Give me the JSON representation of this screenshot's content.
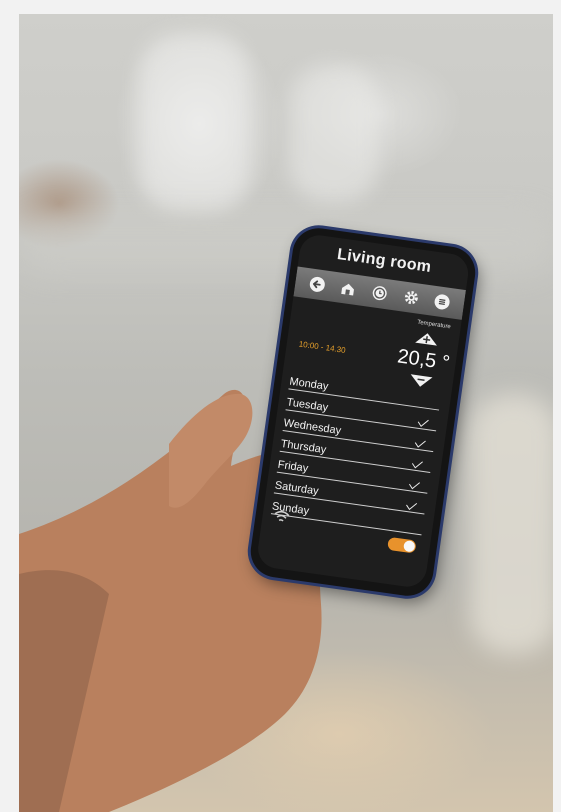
{
  "app": {
    "title": "Living room"
  },
  "toolbar": {
    "icons": [
      "back-arrow-icon",
      "home-icon",
      "clock-icon",
      "gear-icon",
      "menu-icon"
    ]
  },
  "thermostat": {
    "temperature_label": "Temperature",
    "time_range": "10:00 - 14.30",
    "temperature_value": "20,5 °"
  },
  "schedule": {
    "days": [
      {
        "label": "Monday",
        "checked": false
      },
      {
        "label": "Tuesday",
        "checked": true
      },
      {
        "label": "Wednesday",
        "checked": true
      },
      {
        "label": "Thursday",
        "checked": true
      },
      {
        "label": "Friday",
        "checked": true
      },
      {
        "label": "Saturday",
        "checked": true
      },
      {
        "label": "Sunday",
        "checked": false
      }
    ]
  },
  "status": {
    "wifi": "wifi-icon",
    "toggle_on": true
  },
  "colors": {
    "accent": "#e8922c",
    "screen_bg": "#1e1e1e",
    "toolbar_bg": "#6a6a6a",
    "phone_frame": "#2b3a6b"
  }
}
